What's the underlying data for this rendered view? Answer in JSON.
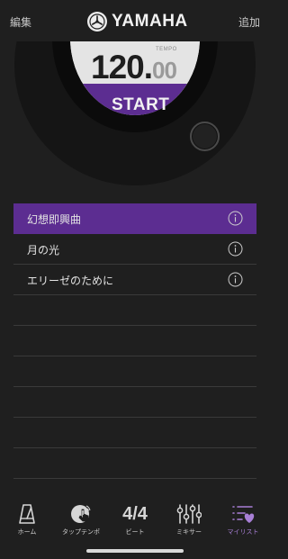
{
  "header": {
    "left_label": "編集",
    "brand": "YAMAHA",
    "right_label": "追加"
  },
  "metronome": {
    "tempo_label": "TEMPO",
    "tempo_integer": "120",
    "tempo_separator": ".",
    "tempo_decimal": "00",
    "start_label": "START"
  },
  "playlist": {
    "items": [
      {
        "label": "幻想即興曲"
      },
      {
        "label": "月の光"
      },
      {
        "label": "エリーゼのために"
      }
    ]
  },
  "tabs": {
    "home": "ホーム",
    "tap_tempo": "タップテンポ",
    "beat_value": "4/4",
    "beat": "ビート",
    "mixer": "ミキサー",
    "my_list": "マイリスト"
  },
  "colors": {
    "accent": "#5c2d91",
    "background": "#1f1f1f"
  }
}
